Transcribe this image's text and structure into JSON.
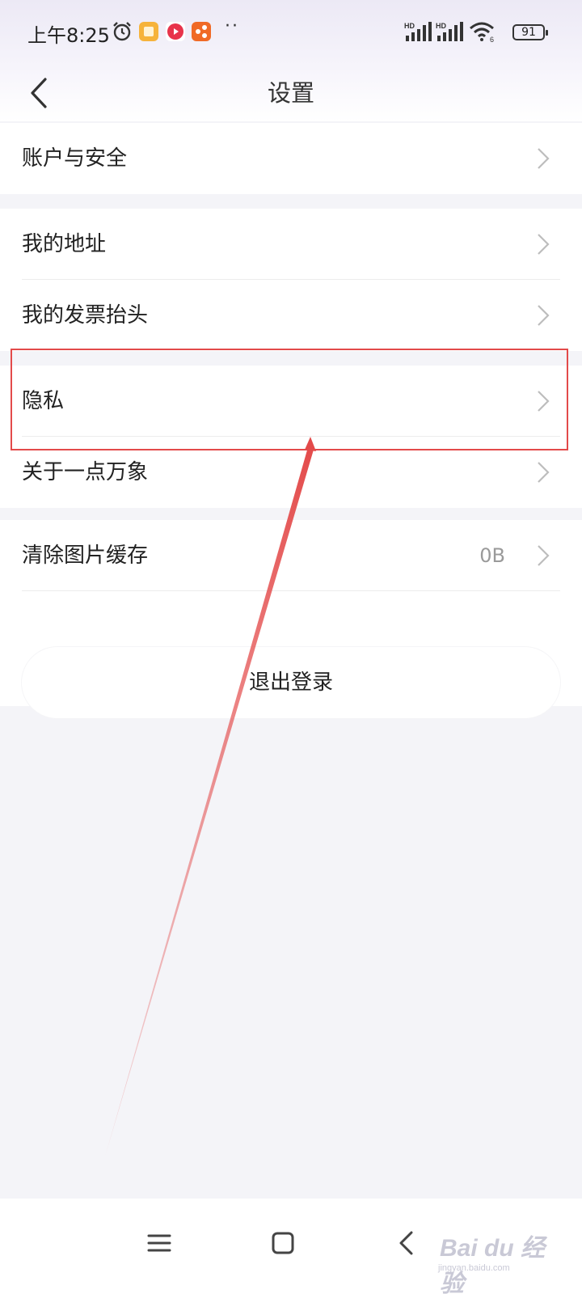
{
  "status_bar": {
    "time": "上午8:25",
    "signal_label_1": "HD",
    "signal_label_2": "HD",
    "wifi_sub": "6",
    "battery": "91",
    "more": "··"
  },
  "header": {
    "title": "设置"
  },
  "settings": {
    "group1": [
      {
        "label": "账户与安全"
      }
    ],
    "group2": [
      {
        "label": "我的地址"
      },
      {
        "label": "我的发票抬头"
      },
      {
        "label": "隐私"
      },
      {
        "label": "关于一点万象"
      }
    ],
    "group3": [
      {
        "label": "清除图片缓存",
        "value": "0B"
      }
    ]
  },
  "logout_label": "退出登录",
  "annotation": {
    "highlight_color": "#e34a4a"
  },
  "watermark": {
    "text": "Bai du 经验",
    "url": "jingyan.baidu.com"
  },
  "icons": [
    "alarm-icon",
    "app-notes-icon",
    "app-video-icon",
    "app-share-icon",
    "signal-icon",
    "wifi-icon",
    "battery-icon",
    "back-arrow-icon",
    "chevron-right-icon",
    "menu-icon",
    "home-icon",
    "back-icon"
  ]
}
